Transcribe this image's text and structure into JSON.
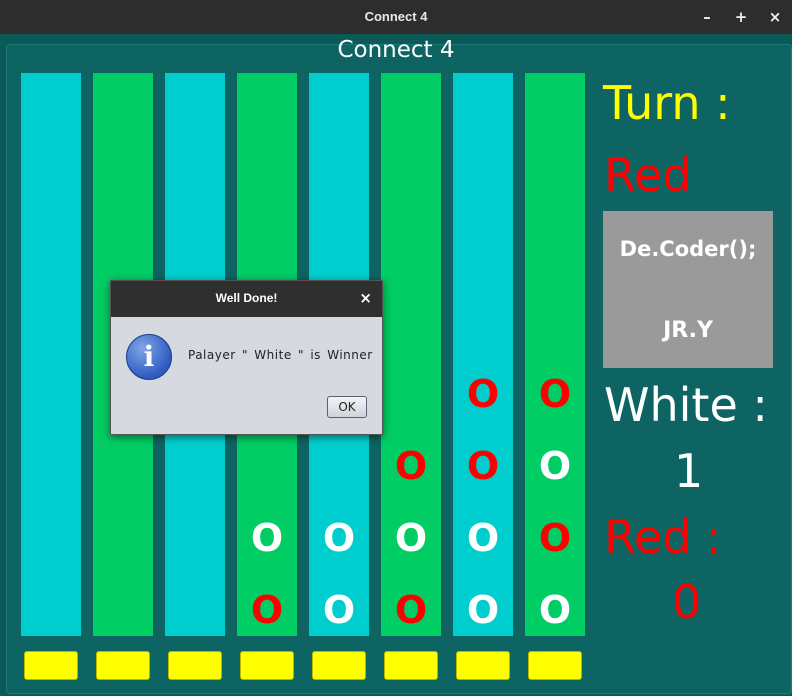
{
  "window": {
    "title": "Connect 4",
    "minimize_label": "–",
    "maximize_label": "+",
    "close_label": "×"
  },
  "game_title": "Connect 4",
  "board": {
    "colors": {
      "cyan": "#00cece",
      "green": "#00cd64",
      "red_piece": "#ff0000",
      "white_piece": "#ffffff",
      "drop_button": "#ffff00"
    },
    "piece_glyph": "O",
    "columns": [
      {
        "color": "cyan",
        "pieces": []
      },
      {
        "color": "green",
        "pieces": []
      },
      {
        "color": "cyan",
        "pieces": []
      },
      {
        "color": "green",
        "pieces": [
          "red",
          "white"
        ]
      },
      {
        "color": "cyan",
        "pieces": [
          "white",
          "white"
        ]
      },
      {
        "color": "green",
        "pieces": [
          "red",
          "white",
          "red"
        ]
      },
      {
        "color": "cyan",
        "pieces": [
          "white",
          "white",
          "red",
          "red"
        ]
      },
      {
        "color": "green",
        "pieces": [
          "white",
          "red",
          "white",
          "red"
        ]
      }
    ]
  },
  "sidebar": {
    "turn_label": "Turn :",
    "turn_value": "Red",
    "logo_line1": "De.Coder();",
    "logo_line2": "JR.Y",
    "white_label": "White :",
    "white_score": "1",
    "red_label": "Red :",
    "red_score": "0",
    "colors": {
      "turn_label": "#ffff00",
      "red": "#ff0000",
      "white": "#ffffff",
      "logo_bg": "#9a9a9a"
    }
  },
  "dialog": {
    "title": "Well Done!",
    "close_label": "×",
    "icon": "info-icon",
    "icon_glyph": "i",
    "message": "Palayer \" White \" is Winner",
    "ok_label": "OK"
  }
}
